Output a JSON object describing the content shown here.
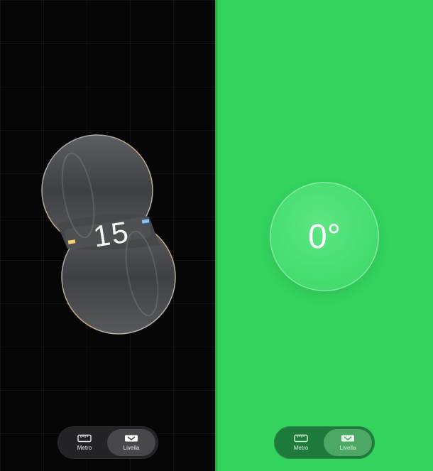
{
  "left_screen": {
    "reading": "15",
    "tabs": [
      {
        "label": "Metro",
        "icon": "ruler-icon",
        "active": false
      },
      {
        "label": "Livella",
        "icon": "level-icon",
        "active": true
      }
    ]
  },
  "right_screen": {
    "angle": "0°",
    "background_color": "#33d35e",
    "tabs": [
      {
        "label": "Metro",
        "icon": "ruler-icon",
        "active": false
      },
      {
        "label": "Livella",
        "icon": "level-icon",
        "active": true
      }
    ]
  }
}
